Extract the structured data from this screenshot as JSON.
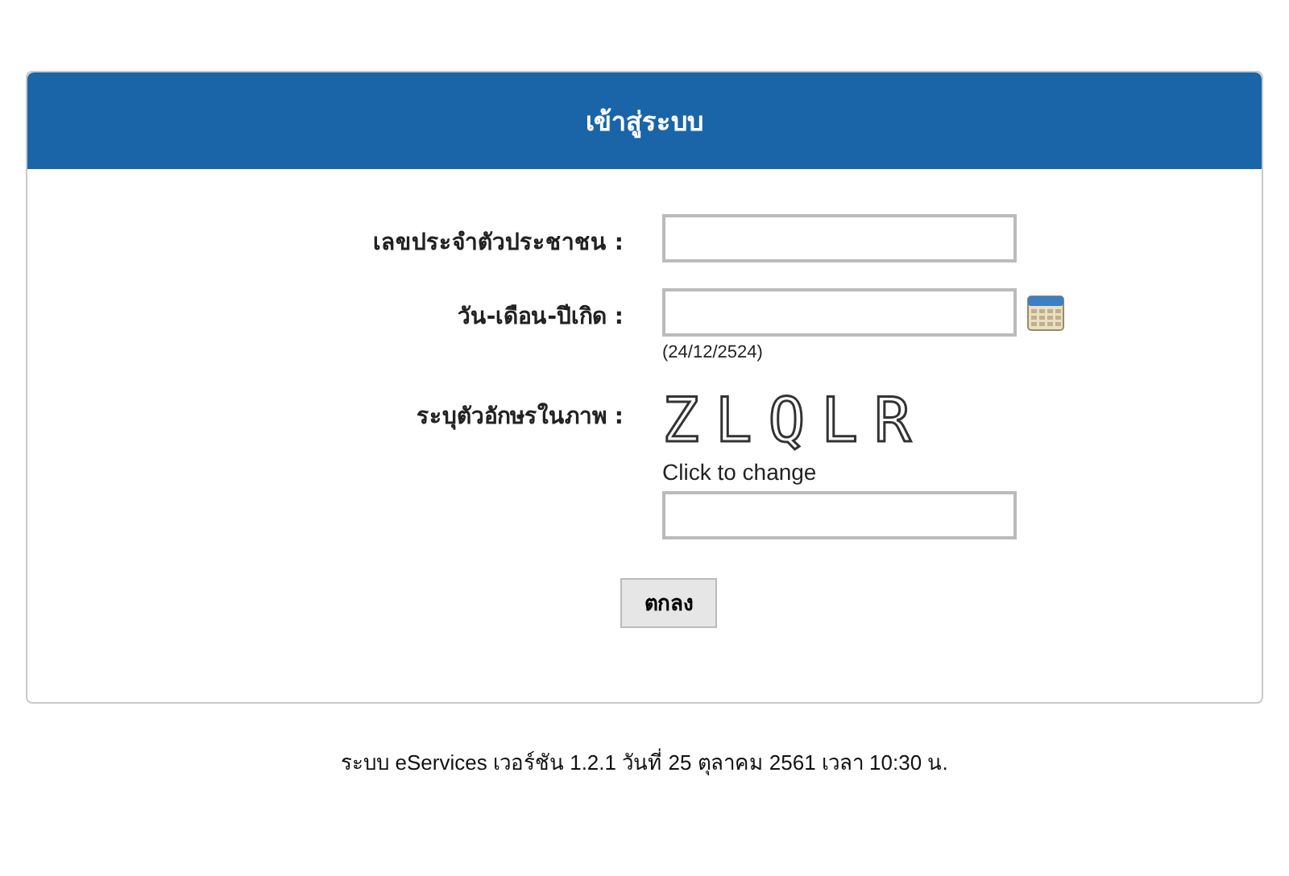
{
  "panel": {
    "title": "เข้าสู่ระบบ"
  },
  "fields": [
    {
      "kind": "text",
      "label": "เลขประจำตัวประชาชน :"
    },
    {
      "kind": "date",
      "label": "วัน-เดือน-ปีเกิด :",
      "hint": "(24/12/2524)"
    },
    {
      "kind": "captcha",
      "label": "ระบุตัวอักษรในภาพ :",
      "captcha": "ZLQLR",
      "link": "Click to change"
    }
  ],
  "submit": "ตกลง",
  "footer": "ระบบ eServices เวอร์ชัน 1.2.1 วันที่ 25 ตุลาคม 2561 เวลา 10:30 น."
}
